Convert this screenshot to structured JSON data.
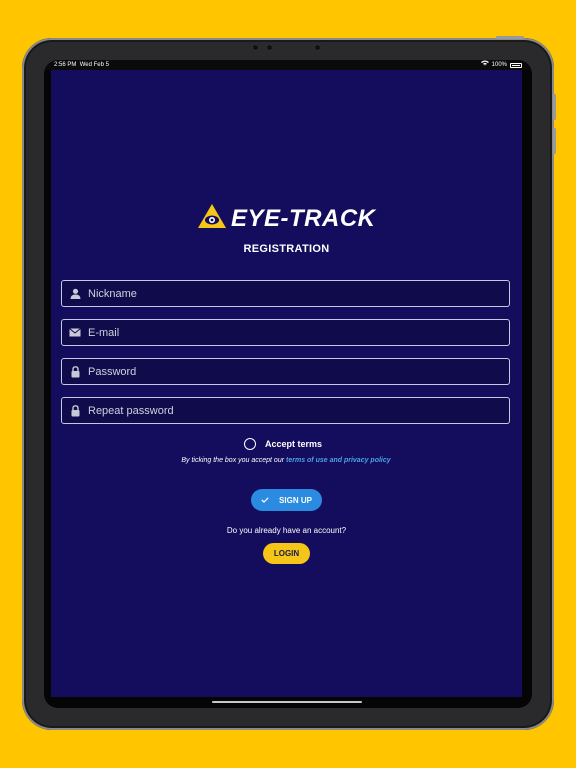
{
  "status_bar": {
    "time": "2:56 PM",
    "date": "Wed Feb 5",
    "battery": "100%"
  },
  "brand": {
    "logo_text": "EYE-TRACK"
  },
  "page": {
    "title": "REGISTRATION"
  },
  "form": {
    "nickname_placeholder": "Nickname",
    "email_placeholder": "E-mail",
    "password_placeholder": "Password",
    "repeat_password_placeholder": "Repeat password"
  },
  "terms": {
    "accept_label": "Accept terms",
    "prefix": "By ticking the box you accept our",
    "link": "terms of use and privacy policy"
  },
  "actions": {
    "signup_label": "SIGN UP",
    "already_text": "Do you already have an account?",
    "login_label": "LOGIN"
  },
  "colors": {
    "page_background": "#FFC600",
    "screen_background": "#140C5C",
    "signup_button": "#2A8BE0",
    "login_button": "#F5C518",
    "link": "#4aa3e8"
  },
  "icons": [
    "user-icon",
    "mail-icon",
    "lock-icon",
    "check-icon",
    "wifi-icon",
    "battery-icon",
    "eye-logo-icon"
  ]
}
